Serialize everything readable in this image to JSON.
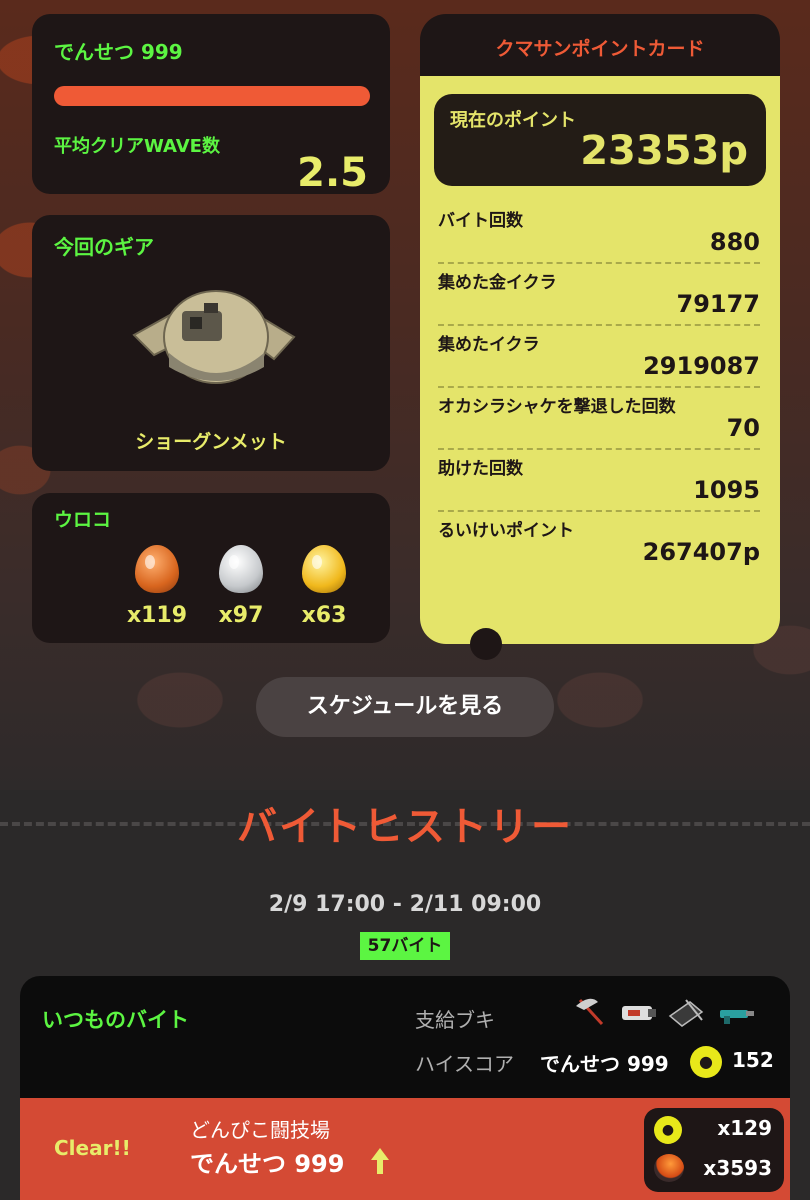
{
  "grade": {
    "name": "でんせつ 999",
    "avg_wave_label": "平均クリアWAVE数",
    "avg_wave_value": "2.5",
    "bar_color": "#ef5a36"
  },
  "gear": {
    "title": "今回のギア",
    "name": "ショーグンメット"
  },
  "scales": {
    "title": "ウロコ",
    "items": [
      {
        "type": "bronze",
        "count": "x119"
      },
      {
        "type": "silver",
        "count": "x97"
      },
      {
        "type": "gold",
        "count": "x63"
      }
    ]
  },
  "point_card": {
    "title": "クマサンポイントカード",
    "current_label": "現在のポイント",
    "current_value": "23353p",
    "stats": [
      {
        "label": "バイト回数",
        "value": "880"
      },
      {
        "label": "集めた金イクラ",
        "value": "79177"
      },
      {
        "label": "集めたイクラ",
        "value": "2919087"
      },
      {
        "label": "オカシラシャケを撃退した回数",
        "value": "70"
      },
      {
        "label": "助けた回数",
        "value": "1095"
      },
      {
        "label": "るいけいポイント",
        "value": "267407p"
      }
    ]
  },
  "schedule_button": "スケジュールを見る",
  "history": {
    "title": "バイトヒストリー",
    "period": "2/9 17:00 - 2/11 09:00",
    "count": "57バイト",
    "shift": {
      "type": "いつものバイト",
      "weapons_label": "支給ブキ",
      "highscore_label": "ハイスコア",
      "highscore_grade": "でんせつ 999",
      "highscore_value": "152",
      "result": "Clear!!",
      "stage": "どんぴこ闘技場",
      "result_grade": "でんせつ 999",
      "golden_eggs": "x129",
      "power_eggs": "x3593"
    }
  },
  "colors": {
    "accent_green": "#5cf542",
    "accent_yellow": "#e8ec6a",
    "accent_orange": "#ef5a36",
    "card_yellow": "#e4e46a"
  }
}
